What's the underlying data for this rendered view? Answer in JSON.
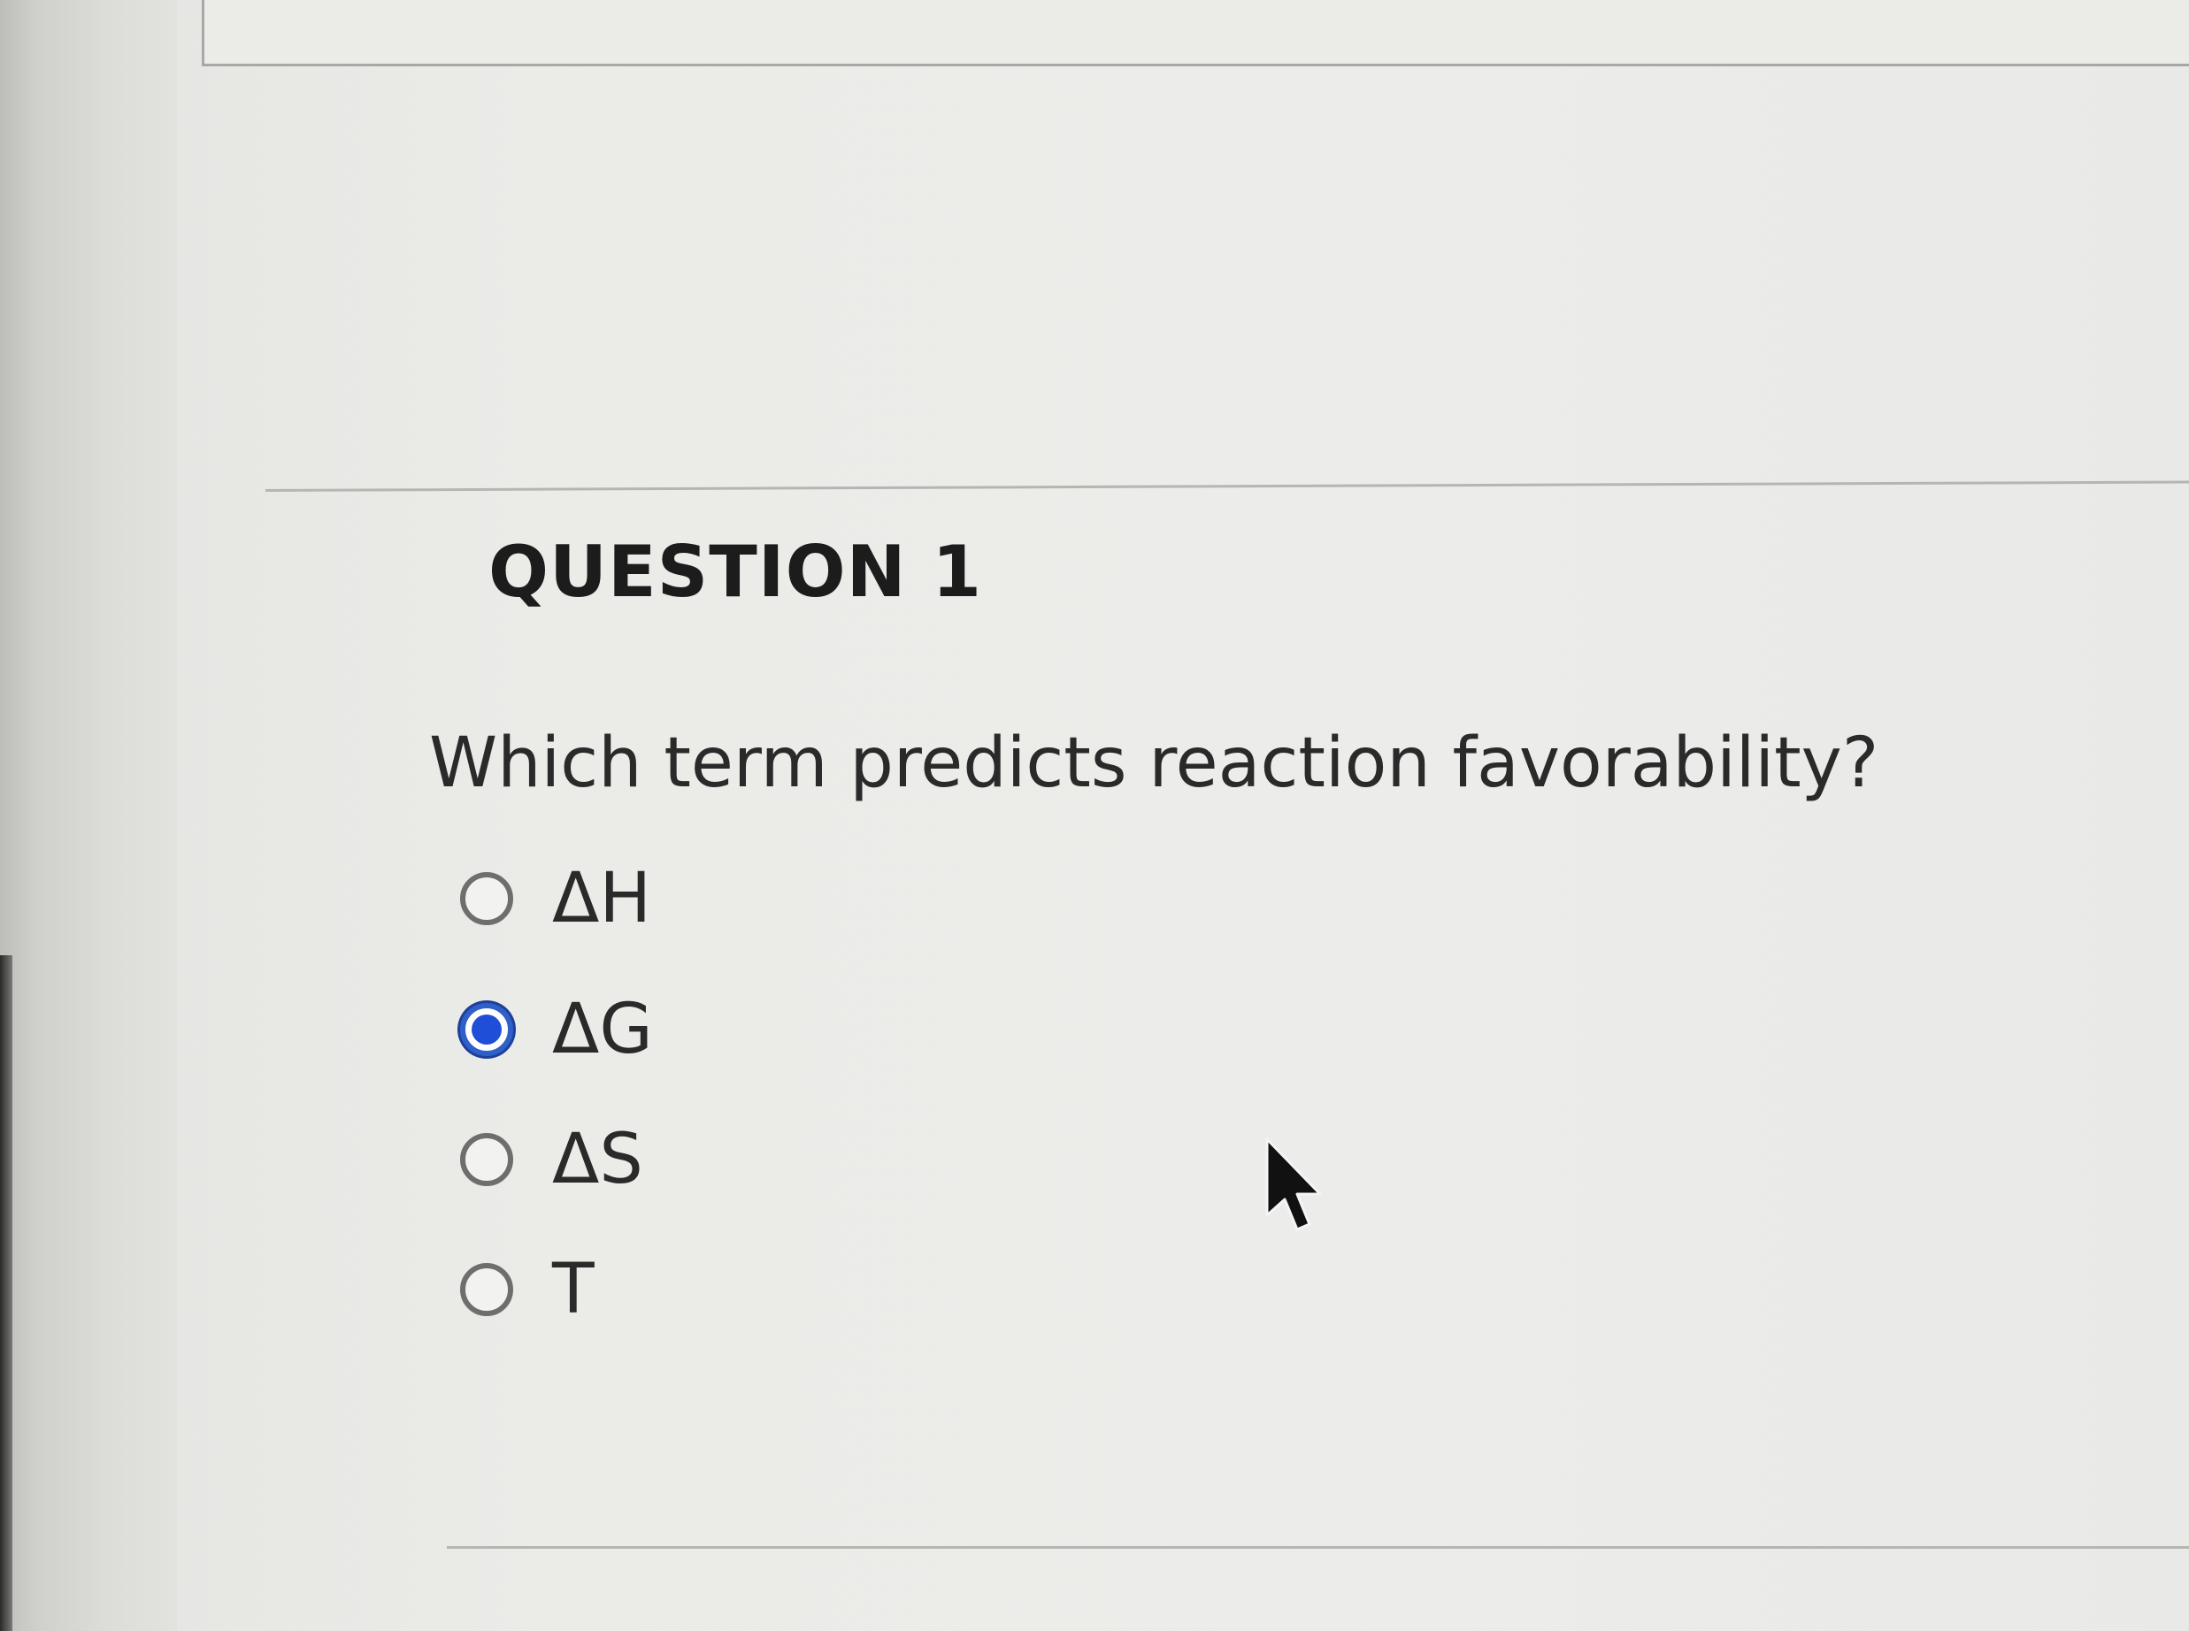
{
  "question": {
    "title": "QUESTION 1",
    "text": "Which term predicts reaction favorability?",
    "options": [
      {
        "label": "ΔH",
        "selected": false
      },
      {
        "label": "ΔG",
        "selected": true
      },
      {
        "label": "ΔS",
        "selected": false
      },
      {
        "label": "T",
        "selected": false
      }
    ]
  },
  "colors": {
    "selected_radio": "#1f4fd6",
    "radio_border": "#6e6e6e",
    "text": "#2a2a2a"
  },
  "icons": {
    "cursor": "mouse-pointer-icon"
  }
}
